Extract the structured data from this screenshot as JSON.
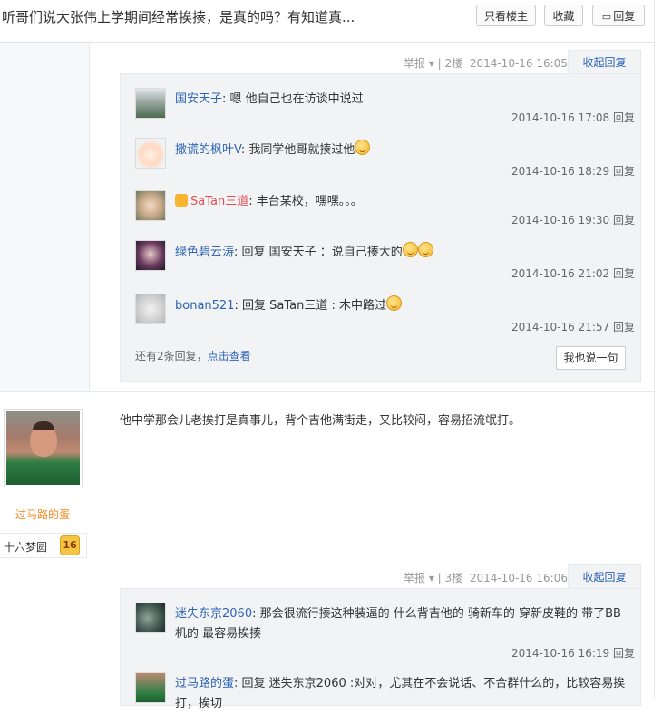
{
  "header": {
    "title": "听哥们说大张伟上学期间经常挨揍，是真的吗？有知道真...",
    "btn_only_host": "只看楼主",
    "btn_collect": "收藏",
    "btn_reply": "回复"
  },
  "floor2": {
    "meta_report": "举报",
    "meta_floor": "| 2楼",
    "meta_time": "2014-10-16 16:05",
    "fold": "收起回复",
    "comments": [
      {
        "user": "国安天子",
        "text": "嗯 他自己也在访谈中说过",
        "time": "2014-10-16 17:08",
        "reply": "回复"
      },
      {
        "user": "撒谎的枫叶V",
        "text": "我同学他哥就揍过他",
        "time": "2014-10-16 18:29",
        "reply": "回复"
      },
      {
        "user": "SaTan三道",
        "text": "丰台某校，嘿嘿。。。",
        "time": "2014-10-16 19:30",
        "reply": "回复"
      },
      {
        "user": "绿色碧云涛",
        "text": "回复 国安天子 ：说自己揍大的",
        "time": "2014-10-16 21:02",
        "reply": "回复"
      },
      {
        "user": "bonan521",
        "text": "回复 SaTan三道 : 木中路过",
        "time": "2014-10-16 21:57",
        "reply": "回复"
      }
    ],
    "more_text": "还有2条回复，",
    "more_link": "点击查看",
    "say_btn": "我也说一句"
  },
  "post3": {
    "author": "过马路的蛋",
    "badge_name": "十六梦圆",
    "badge_level": "16",
    "content": "他中学那会儿老挨打是真事儿，背个吉他满街走，又比较闷，容易招流氓打。",
    "meta_report": "举报",
    "meta_floor": "| 3楼",
    "meta_time": "2014-10-16 16:06",
    "fold": "收起回复",
    "comments": [
      {
        "user": "迷失东京2060",
        "text": "那会很流行揍这种装逼的 什么背吉他的 骑新车的 穿新皮鞋的 带了BB机的 最容易挨揍",
        "time": "2014-10-16 16:19",
        "reply": "回复"
      },
      {
        "user": "过马路的蛋",
        "text": "回复 迷失东京2060 :对对，尤其在不会说话、不合群什么的，比较容易挨打，挨切"
      }
    ]
  },
  "colors": {
    "link": "#2d64b3",
    "vip_name": "#e15151",
    "author": "#f08a24"
  }
}
